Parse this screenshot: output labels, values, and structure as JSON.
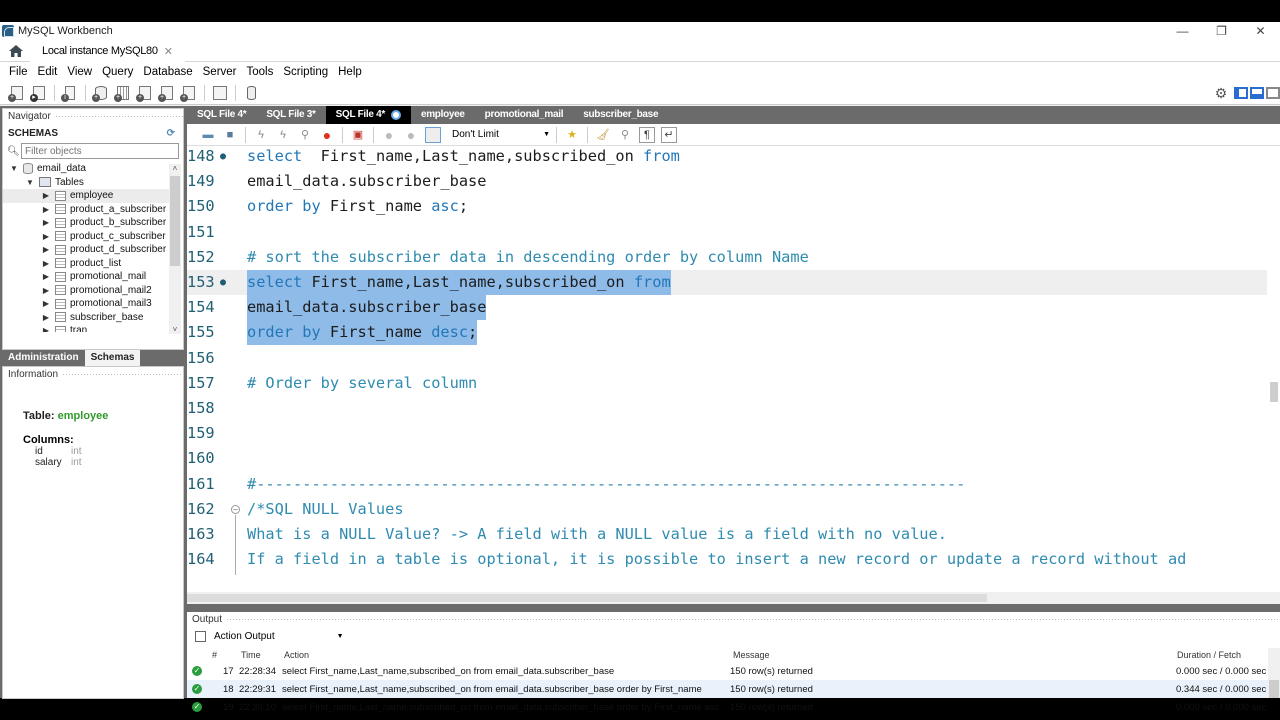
{
  "window": {
    "app_title": "MySQL Workbench",
    "connection_tab": "Local instance MySQL80",
    "controls": {
      "minimize": "—",
      "restore": "❐",
      "close": "✕"
    }
  },
  "menu": [
    "File",
    "Edit",
    "View",
    "Query",
    "Database",
    "Server",
    "Tools",
    "Scripting",
    "Help"
  ],
  "main_toolbar": {
    "icons": [
      "new-sql-tab-icon",
      "open-sql-script-icon",
      "inspector-icon",
      "create-schema-icon",
      "create-table-icon",
      "create-view-icon",
      "create-procedure-icon",
      "create-function-icon",
      "search-table-data-icon",
      "reconnect-icon"
    ],
    "right_icons": [
      "settings-icon",
      "toggle-sidebar-icon",
      "toggle-output-icon",
      "toggle-secondary-sidebar-icon"
    ]
  },
  "navigator": {
    "title": "Navigator",
    "schemas_label": "SCHEMAS",
    "filter_placeholder": "Filter objects",
    "schema": "email_data",
    "tables_label": "Tables",
    "tables": [
      "employee",
      "product_a_subscriber",
      "product_b_subscriber",
      "product_c_subscriber",
      "product_d_subscriber",
      "product_list",
      "promotional_mail",
      "promotional_mail2",
      "promotional_mail3",
      "subscriber_base",
      "tran"
    ],
    "selected_table": "employee"
  },
  "side_tabs": {
    "administration": "Administration",
    "schemas": "Schemas"
  },
  "information": {
    "title": "Information",
    "table_label": "Table:",
    "table_name": "employee",
    "columns_label": "Columns:",
    "columns": [
      {
        "name": "id",
        "type": "int"
      },
      {
        "name": "salary",
        "type": "int"
      }
    ]
  },
  "editor_tabs": [
    {
      "label": "SQL File 4*",
      "active": false
    },
    {
      "label": "SQL File 3*",
      "active": false
    },
    {
      "label": "SQL File 4*",
      "active": true
    },
    {
      "label": "employee",
      "active": false
    },
    {
      "label": "promotional_mail",
      "active": false
    },
    {
      "label": "subscriber_base",
      "active": false
    }
  ],
  "editor_toolbar": {
    "limit": "Don't Limit"
  },
  "editor": {
    "lines": [
      {
        "n": "148",
        "dot": true,
        "parts": [
          [
            "kw",
            "select"
          ],
          [
            "",
            "  First_name,Last_name,subscribed_on "
          ],
          [
            "kw",
            "from"
          ]
        ]
      },
      {
        "n": "149",
        "parts": [
          [
            "",
            "email_data.subscriber_base"
          ]
        ]
      },
      {
        "n": "150",
        "parts": [
          [
            "kw",
            "order by"
          ],
          [
            "",
            " First_name "
          ],
          [
            "kw",
            "asc"
          ],
          [
            "",
            ";"
          ]
        ]
      },
      {
        "n": "151",
        "parts": []
      },
      {
        "n": "152",
        "parts": [
          [
            "cm",
            "# sort the subscriber data in descending order by column Name"
          ]
        ]
      },
      {
        "n": "153",
        "dot": true,
        "sel": true,
        "parts": [
          [
            "kw",
            "select"
          ],
          [
            "",
            " First_name,Last_name,subscribed_on "
          ],
          [
            "kw",
            "from"
          ]
        ]
      },
      {
        "n": "154",
        "sel": true,
        "parts": [
          [
            "",
            "email_data.subscriber_base"
          ]
        ]
      },
      {
        "n": "155",
        "sel": true,
        "parts": [
          [
            "kw",
            "order by"
          ],
          [
            "",
            " First_name "
          ],
          [
            "kw",
            "desc"
          ],
          [
            "",
            ";"
          ]
        ]
      },
      {
        "n": "156",
        "parts": []
      },
      {
        "n": "157",
        "parts": [
          [
            "cm",
            "# Order by several column"
          ]
        ]
      },
      {
        "n": "158",
        "parts": []
      },
      {
        "n": "159",
        "parts": []
      },
      {
        "n": "160",
        "parts": []
      },
      {
        "n": "161",
        "parts": [
          [
            "cm",
            "#-----------------------------------------------------------------------------"
          ]
        ]
      },
      {
        "n": "162",
        "fold": true,
        "parts": [
          [
            "cm",
            "/*SQL NULL Values"
          ]
        ]
      },
      {
        "n": "163",
        "parts": [
          [
            "cm",
            "What is a NULL Value? -> A field with a NULL value is a field with no value."
          ]
        ]
      },
      {
        "n": "164",
        "parts": [
          [
            "cm",
            "If a field in a table is optional, it is possible to insert a new record or update a record without ad"
          ]
        ]
      }
    ]
  },
  "output": {
    "title": "Output",
    "selector": "Action Output",
    "columns": [
      "#",
      "Time",
      "Action",
      "Message",
      "Duration / Fetch"
    ],
    "rows": [
      {
        "num": "17",
        "time": "22:28:34",
        "action": "select First_name,Last_name,subscribed_on from  email_data.subscriber_base",
        "message": "150 row(s) returned",
        "duration": "0.000 sec / 0.000 sec",
        "status": "ok"
      },
      {
        "num": "18",
        "time": "22:29:31",
        "action": "select First_name,Last_name,subscribed_on from  email_data.subscriber_base order by First_name",
        "message": "150 row(s) returned",
        "duration": "0.344 sec / 0.000 sec",
        "status": "ok"
      },
      {
        "num": "19",
        "time": "22:30:10",
        "action": "select First_name,Last_name,subscribed_on from  email_data.subscriber_base order by First_name asc",
        "message": "150 row(s) returned",
        "duration": "0.000 sec / 0.000 sec",
        "status": "ok"
      }
    ]
  },
  "colors": {
    "keyword": "#2277b9",
    "comment": "#2f8bb0",
    "selection": "#8fbbe8",
    "success": "#2a9d3e",
    "table_name_green": "#2f9b2f"
  }
}
